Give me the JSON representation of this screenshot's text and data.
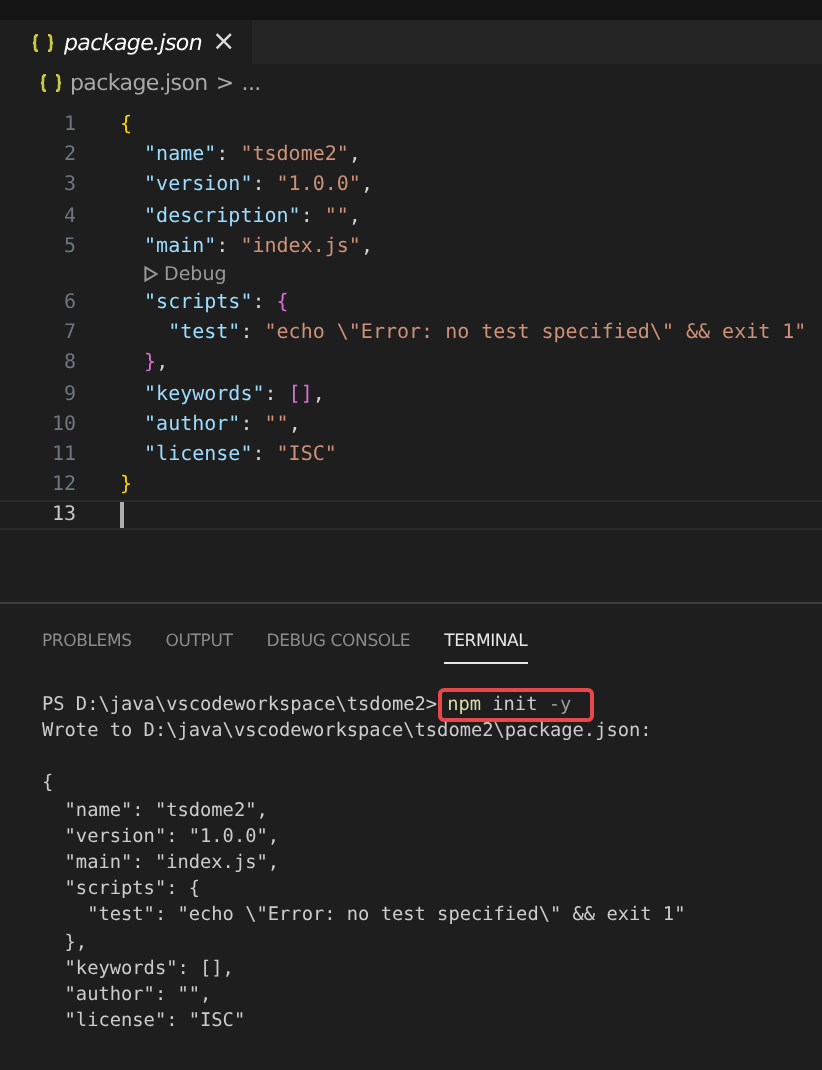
{
  "tab": {
    "label": "package.json",
    "selected": true,
    "close": "×"
  },
  "breadcrumb": {
    "file": "package.json",
    "separator": ">",
    "more": "..."
  },
  "editor": {
    "lines": [
      {
        "number": "1",
        "tokens": [
          {
            "kind": "brace",
            "text": "{"
          }
        ]
      },
      {
        "number": "2",
        "tokens": [
          {
            "kind": "key",
            "text": "  \"name\""
          },
          {
            "kind": "punct",
            "text": ": "
          },
          {
            "kind": "string",
            "text": "\"tsdome2\""
          },
          {
            "kind": "punct",
            "text": ","
          }
        ]
      },
      {
        "number": "3",
        "tokens": [
          {
            "kind": "key",
            "text": "  \"version\""
          },
          {
            "kind": "punct",
            "text": ": "
          },
          {
            "kind": "string",
            "text": "\"1.0.0\""
          },
          {
            "kind": "punct",
            "text": ","
          }
        ]
      },
      {
        "number": "4",
        "tokens": [
          {
            "kind": "key",
            "text": "  \"description\""
          },
          {
            "kind": "punct",
            "text": ": "
          },
          {
            "kind": "string",
            "text": "\"\""
          },
          {
            "kind": "punct",
            "text": ","
          }
        ]
      },
      {
        "number": "5",
        "tokens": [
          {
            "kind": "key",
            "text": "  \"main\""
          },
          {
            "kind": "punct",
            "text": ": "
          },
          {
            "kind": "string",
            "text": "\"index.js\""
          },
          {
            "kind": "punct",
            "text": ","
          }
        ],
        "codelens": "Debug"
      },
      {
        "number": "6",
        "tokens": [
          {
            "kind": "key",
            "text": "  \"scripts\""
          },
          {
            "kind": "punct",
            "text": ": "
          },
          {
            "kind": "brace2",
            "text": "{"
          }
        ]
      },
      {
        "number": "7",
        "tokens": [
          {
            "kind": "key",
            "text": "    \"test\""
          },
          {
            "kind": "punct",
            "text": ": "
          },
          {
            "kind": "string",
            "text": "\"echo \\\"Error: no test specified\\\" && exit 1\""
          }
        ]
      },
      {
        "number": "8",
        "tokens": [
          {
            "kind": "brace2",
            "text": "  }"
          },
          {
            "kind": "punct",
            "text": ","
          }
        ]
      },
      {
        "number": "9",
        "tokens": [
          {
            "kind": "key",
            "text": "  \"keywords\""
          },
          {
            "kind": "punct",
            "text": ": "
          },
          {
            "kind": "brace2",
            "text": "[]"
          },
          {
            "kind": "punct",
            "text": ","
          }
        ]
      },
      {
        "number": "10",
        "tokens": [
          {
            "kind": "key",
            "text": "  \"author\""
          },
          {
            "kind": "punct",
            "text": ": "
          },
          {
            "kind": "string",
            "text": "\"\""
          },
          {
            "kind": "punct",
            "text": ","
          }
        ]
      },
      {
        "number": "11",
        "tokens": [
          {
            "kind": "key",
            "text": "  \"license\""
          },
          {
            "kind": "punct",
            "text": ": "
          },
          {
            "kind": "string",
            "text": "\"ISC\""
          }
        ]
      },
      {
        "number": "12",
        "tokens": [
          {
            "kind": "brace",
            "text": "}"
          }
        ]
      },
      {
        "number": "13",
        "current": true
      }
    ]
  },
  "panel_tabs": [
    {
      "label": "PROBLEMS",
      "selected": false
    },
    {
      "label": "OUTPUT",
      "selected": false
    },
    {
      "label": "DEBUG CONSOLE",
      "selected": false
    },
    {
      "label": "TERMINAL",
      "selected": true
    }
  ],
  "terminal": {
    "prompt": "PS D:\\java\\vscodeworkspace\\tsdome2>",
    "command": [
      {
        "kind": "program",
        "text": "npm"
      },
      {
        "kind": "arg",
        "text": " init"
      },
      {
        "kind": "flag",
        "text": " -y"
      }
    ],
    "command_highlighted": true,
    "output": [
      "Wrote to D:\\java\\vscodeworkspace\\tsdome2\\package.json:"
    ],
    "printed_json": [
      "{",
      "  \"name\": \"tsdome2\",",
      "  \"version\": \"1.0.0\",",
      "  \"main\": \"index.js\",",
      "  \"scripts\": {",
      "    \"test\": \"echo \\\"Error: no test specified\\\" && exit 1\"",
      "  },",
      "  \"keywords\": [],",
      "  \"author\": \"\",",
      "  \"license\": \"ISC\""
    ]
  }
}
